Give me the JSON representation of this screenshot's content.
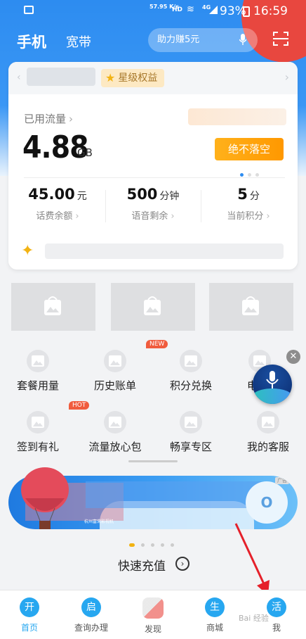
{
  "status_bar": {
    "speed": "57.95 K/s",
    "hd": "HD",
    "network": "4G",
    "battery_percent": "93%",
    "time": "16:59"
  },
  "header": {
    "tab_phone": "手机",
    "tab_broadband": "宽带",
    "search_placeholder": "助力赚5元"
  },
  "card": {
    "star_badge": "星级权益",
    "used_label": "已用流量",
    "used_value": "4.88",
    "used_unit": "GB",
    "button_label": "绝不落空",
    "stats": [
      {
        "value": "45.00",
        "unit": "元",
        "label": "话费余额"
      },
      {
        "value": "500",
        "unit": "分钟",
        "label": "语音剩余"
      },
      {
        "value": "5",
        "unit": "分",
        "label": "当前积分"
      }
    ]
  },
  "grid": [
    {
      "label": "套餐用量",
      "tag": ""
    },
    {
      "label": "历史账单",
      "tag": "NEW"
    },
    {
      "label": "积分兑换",
      "tag": ""
    },
    {
      "label": "电",
      "tag": ""
    },
    {
      "label": "签到有礼",
      "tag": "HOT"
    },
    {
      "label": "流量放心包",
      "tag": ""
    },
    {
      "label": "畅享专区",
      "tag": ""
    },
    {
      "label": "我的客服",
      "tag": ""
    }
  ],
  "promo": {
    "circle_text": "O",
    "ad_tag": "广告",
    "sponsor": "杭州富荣影视机"
  },
  "recharge_label": "快速充值",
  "nav": [
    {
      "icon": "开",
      "label": "首页"
    },
    {
      "icon": "启",
      "label": "查询办理"
    },
    {
      "icon": "",
      "label": "发现"
    },
    {
      "icon": "生",
      "label": "商城"
    },
    {
      "icon": "活",
      "label": "我"
    }
  ],
  "watermark": "Bai 经验",
  "colors": {
    "primary": "#2d8cf0",
    "accent": "#ff9800",
    "tag": "#f05b3d",
    "nav_active": "#27a7f0"
  }
}
